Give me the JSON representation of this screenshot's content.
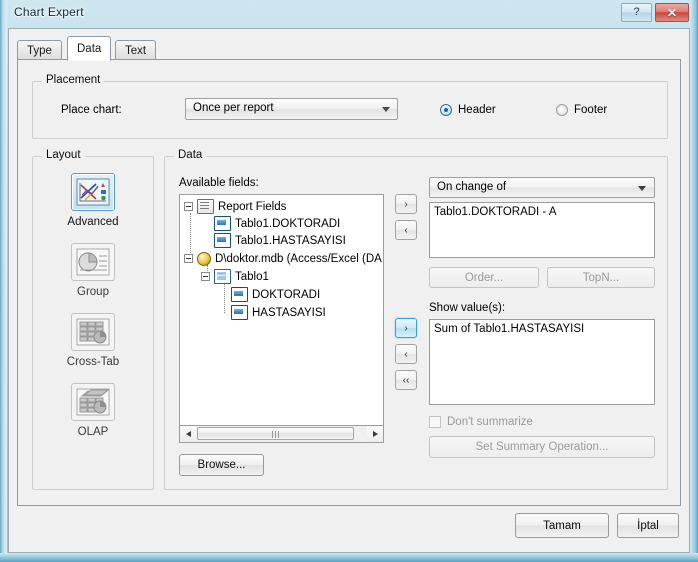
{
  "window": {
    "title": "Chart Expert",
    "help_button": "?",
    "close_button": "✕"
  },
  "tabs": [
    {
      "id": "type",
      "label": "Type",
      "active": false
    },
    {
      "id": "data",
      "label": "Data",
      "active": true
    },
    {
      "id": "text",
      "label": "Text",
      "active": false
    }
  ],
  "placement": {
    "group_label": "Placement",
    "place_chart_label": "Place chart:",
    "place_chart_value": "Once per report",
    "header_label": "Header",
    "footer_label": "Footer",
    "selected_section": "Header"
  },
  "layout": {
    "group_label": "Layout",
    "selected": "Advanced",
    "items": [
      {
        "id": "advanced",
        "label": "Advanced",
        "icon": "advanced-chart-icon",
        "enabled": true
      },
      {
        "id": "group",
        "label": "Group",
        "icon": "group-chart-icon",
        "enabled": false
      },
      {
        "id": "crosstab",
        "label": "Cross-Tab",
        "icon": "crosstab-chart-icon",
        "enabled": false
      },
      {
        "id": "olap",
        "label": "OLAP",
        "icon": "olap-chart-icon",
        "enabled": false
      }
    ]
  },
  "data_panel": {
    "group_label": "Data",
    "available_fields_label": "Available fields:",
    "tree": [
      {
        "level": 0,
        "label": "Report Fields",
        "icon": "report-fields-icon",
        "expander": "minus"
      },
      {
        "level": 1,
        "label": "Tablo1.DOKTORADI",
        "icon": "field-icon",
        "expander": "none"
      },
      {
        "level": 1,
        "label": "Tablo1.HASTASAYISI",
        "icon": "field-icon",
        "expander": "none"
      },
      {
        "level": 0,
        "label": "D\\doktor.mdb (Access/Excel (DA",
        "icon": "database-icon",
        "expander": "minus"
      },
      {
        "level": 1,
        "label": "Tablo1",
        "icon": "table-icon",
        "expander": "minus"
      },
      {
        "level": 2,
        "label": "DOKTORADI",
        "icon": "field-icon",
        "expander": "none"
      },
      {
        "level": 2,
        "label": "HASTASAYISI",
        "icon": "field-icon",
        "expander": "none"
      }
    ],
    "browse_button": "Browse...",
    "transfer_buttons": [
      {
        "id": "add-group",
        "label": "›",
        "highlighted": false
      },
      {
        "id": "remove-group",
        "label": "‹",
        "highlighted": false
      },
      {
        "id": "add-value",
        "label": "›",
        "highlighted": true
      },
      {
        "id": "remove-value",
        "label": "‹",
        "highlighted": false
      },
      {
        "id": "remove-all-values",
        "label": "‹‹",
        "highlighted": false
      }
    ],
    "on_change_of_label": "On change of",
    "on_change_of_items": [
      "Tablo1.DOKTORADI - A"
    ],
    "order_button": "Order...",
    "topn_button": "TopN...",
    "show_values_label": "Show value(s):",
    "show_values_items": [
      "Sum of Tablo1.HASTASAYISI"
    ],
    "dont_summarize_label": "Don't summarize",
    "dont_summarize_checked": false,
    "set_summary_button": "Set Summary Operation..."
  },
  "footer": {
    "ok_button": "Tamam",
    "cancel_button": "İptal"
  },
  "colors": {
    "accent": "#3c9fd4",
    "title_glass": "#a9d3e3",
    "dialog_face": "#f0f0f0",
    "close_red": "#c8463c"
  }
}
